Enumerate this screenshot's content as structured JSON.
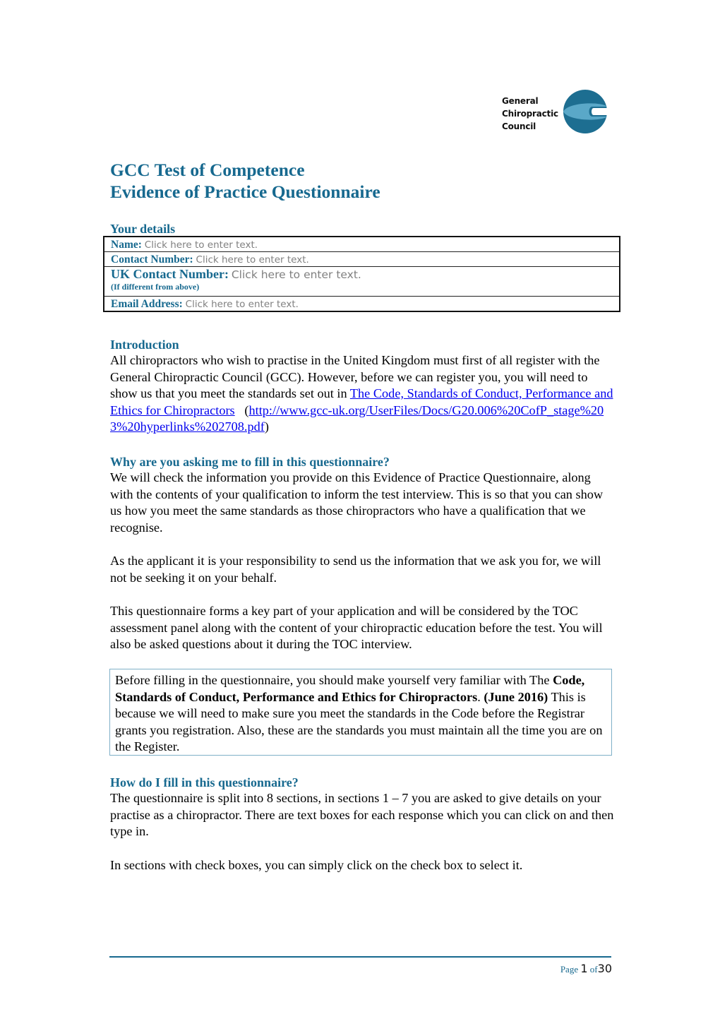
{
  "logo": {
    "line1": "General",
    "line2": "Chiropractic",
    "line3": "Council",
    "colors": {
      "dark": "#1d6e91",
      "light": "#5aa8c8"
    }
  },
  "title": {
    "line1": "GCC Test of Competence",
    "line2": "Evidence of Practice Questionnaire"
  },
  "your_details": {
    "heading": "Your details",
    "fields": [
      {
        "label": "Name:",
        "placeholder": "Click here to enter text."
      },
      {
        "label": "Contact Number:",
        "placeholder": "Click here to enter text."
      },
      {
        "label": "UK Contact Number:",
        "placeholder": "Click here to enter text.",
        "note": "(If different from above)"
      },
      {
        "label": "Email Address:",
        "placeholder": "Click here to enter text."
      }
    ]
  },
  "introduction": {
    "heading": "Introduction",
    "text_before_link": "All chiropractors who wish to practise in the United Kingdom must first of all register with the General Chiropractic Council (GCC). However, before we can register you, you will need to show us that you meet the standards set out in ",
    "link_text": "The Code, Standards of Conduct, Performance and Ethics for Chiropractors",
    "url_open": "   (",
    "url_text": "http://www.gcc-uk.org/UserFiles/Docs/G20.006%20CofP_stage%203%20hyperlinks%202708.pdf",
    "url_close": ")"
  },
  "why": {
    "heading": "Why are you asking me to fill in this questionnaire?",
    "paragraphs": [
      "We will check the information you provide on this Evidence of Practice Questionnaire, along with the contents of your qualification to inform the test interview. This is so that you can show us how you meet the same standards as those chiropractors who have a qualification that we recognise.",
      "As the applicant it is your responsibility to send us the information that we ask you for, we will not be seeking it on your behalf.",
      "This questionnaire forms a key part of your application and will be considered by the TOC assessment panel along with the content of your chiropractic education before the test. You will also be asked questions about it during the TOC interview."
    ]
  },
  "callout": {
    "text_start": "Before filling in the questionnaire, you should make yourself very familiar with The ",
    "bold_title": "Code, Standards of Conduct, Performance and Ethics for Chiropractors",
    "dot": ". ",
    "bold_date": "(June 2016)",
    "text_end": " This is because we will need to make sure you meet the standards in the Code before the Registrar grants you registration. Also, these are the standards you must maintain all the time you are on the Register."
  },
  "how": {
    "heading": "How do I fill in this questionnaire?",
    "paragraphs": [
      "The questionnaire is split into 8 sections, in sections 1 – 7 you are asked to give details on your practise as a chiropractor. There are text boxes for each response which you can click on and then type in.",
      "In sections with check boxes, you can simply click on the check box to select it."
    ]
  },
  "footer": {
    "page_label": "Page",
    "page_number": "1",
    "of_label": "of",
    "total_pages": "30"
  }
}
